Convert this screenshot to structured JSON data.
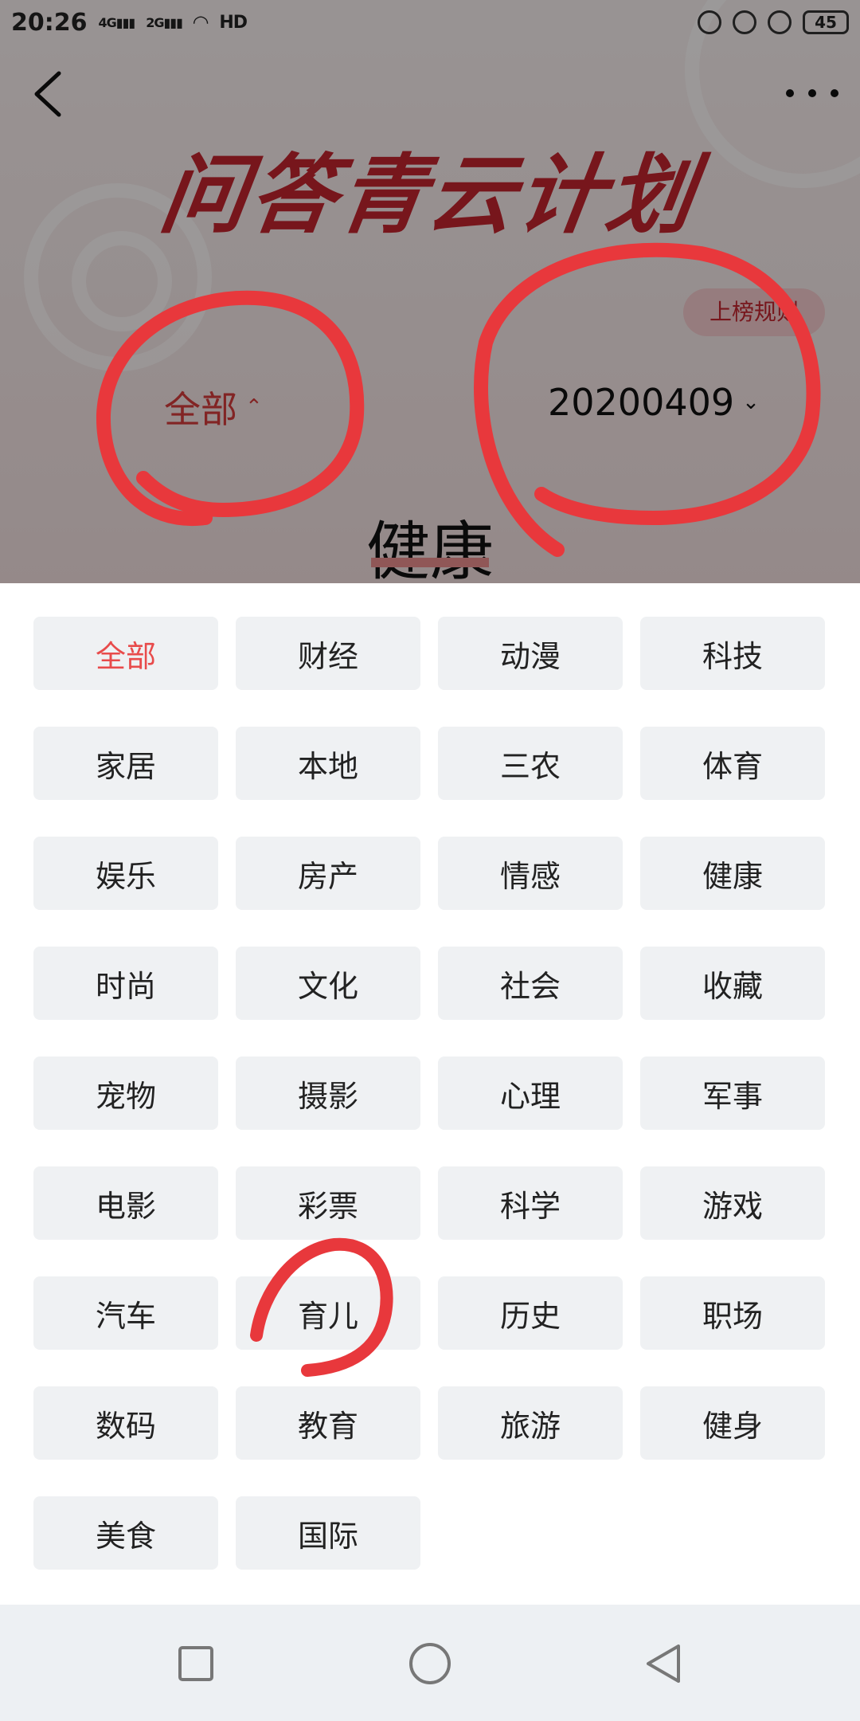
{
  "status_bar": {
    "time": "20:26",
    "signal_1": "4G",
    "signal_2": "2G",
    "hd": "HD",
    "battery": "45"
  },
  "header": {
    "title": "问答青云计划",
    "rules_button": "上榜规则",
    "category_filter": "全部",
    "date_filter": "20200409",
    "current_topic": "健康"
  },
  "categories": [
    "全部",
    "财经",
    "动漫",
    "科技",
    "家居",
    "本地",
    "三农",
    "体育",
    "娱乐",
    "房产",
    "情感",
    "健康",
    "时尚",
    "文化",
    "社会",
    "收藏",
    "宠物",
    "摄影",
    "心理",
    "军事",
    "电影",
    "彩票",
    "科学",
    "游戏",
    "汽车",
    "育儿",
    "历史",
    "职场",
    "数码",
    "教育",
    "旅游",
    "健身",
    "美食",
    "国际"
  ],
  "selected_category": "全部",
  "colors": {
    "accent": "#e84b4b",
    "title_red": "#c0242e",
    "chip_bg": "#eff1f3",
    "annotation": "#e8383c"
  },
  "icons": {
    "back": "chevron-left-icon",
    "more": "more-dots-icon",
    "nav_recent": "square-icon",
    "nav_home": "circle-icon",
    "nav_back": "triangle-back-icon"
  }
}
